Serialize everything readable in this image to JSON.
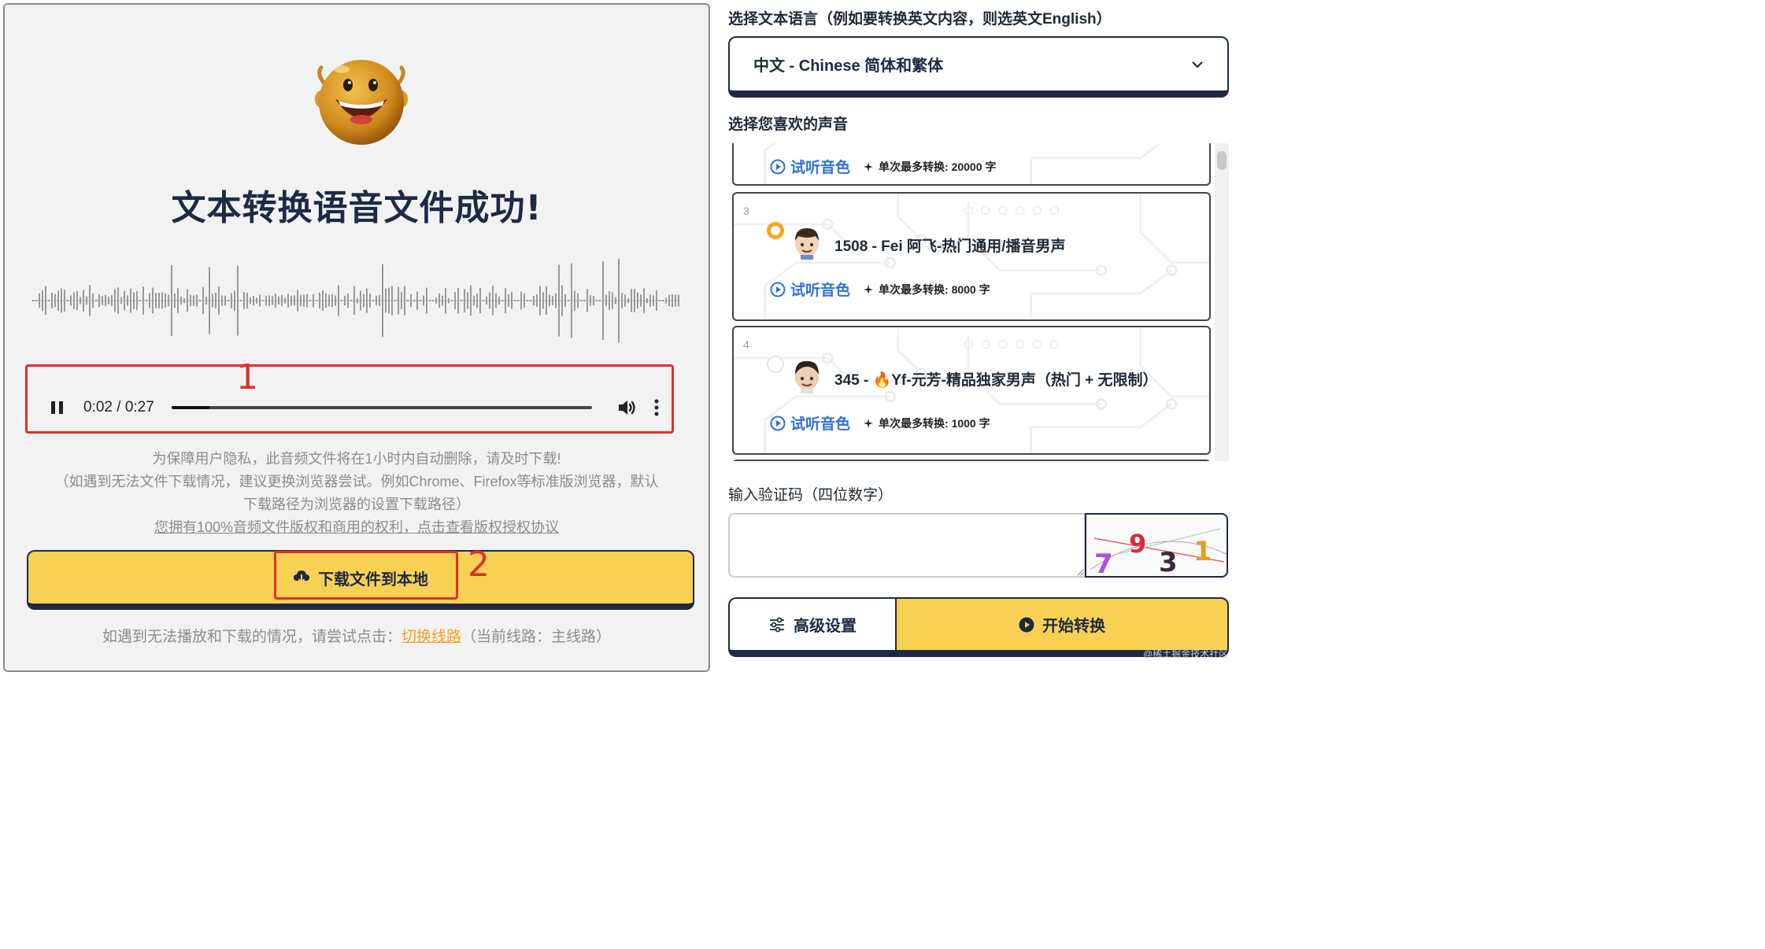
{
  "left": {
    "title": "文本转换语音文件成功!",
    "player": {
      "time": "0:02 / 0:27",
      "current": "0:02",
      "duration": "0:27",
      "progress_fraction": 0.09
    },
    "notice_line1": "为保障用户隐私，此音频文件将在1小时内自动删除，请及时下载!",
    "notice_line2": "（如遇到无法文件下载情况，建议更换浏览器尝试。例如Chrome、Firefox等标准版浏览器，默认",
    "notice_line3": "下载路径为浏览器的设置下载路径）",
    "license_link": "您拥有100%音频文件版权和商用的权利，点击查看版权授权协议",
    "download_label": "下载文件到本地",
    "switch_prefix": "如遇到无法播放和下载的情况，请尝试点击：",
    "switch_link": "切换线路",
    "switch_suffix": "（当前线路：主线路）",
    "annotations": [
      "1",
      "2"
    ]
  },
  "right": {
    "lang_label": "选择文本语言（例如要转换英文内容，则选英文English）",
    "lang_value": "中文 - Chinese 简体和繁体",
    "voice_label": "选择您喜欢的声音",
    "voices": [
      {
        "index": "",
        "name": "",
        "listen": "试听音色",
        "max": "单次最多转换: 20000 字",
        "selected": false
      },
      {
        "index": "3",
        "name": "1508 - Fei 阿飞-热门通用/播音男声",
        "listen": "试听音色",
        "max": "单次最多转换: 8000 字",
        "selected": true
      },
      {
        "index": "4",
        "name": "345 - 🔥Yf-元芳-精品独家男声（热门 + 无限制）",
        "listen": "试听音色",
        "max": "单次最多转换: 1000 字",
        "selected": false
      }
    ],
    "captcha_label": "输入验证码（四位数字）",
    "captcha_value": "",
    "captcha_digits": [
      "7",
      "9",
      "3",
      "1"
    ],
    "settings_label": "高级设置",
    "start_label": "开始转换"
  },
  "watermark": "@稀土掘金技术社区",
  "colors": {
    "navy": "#1e2a44",
    "yellow": "#f8d154",
    "annotation_red": "#e0302a",
    "link_blue": "#2f72d8",
    "link_orange": "#f0a020",
    "radio_selected": "#f5a623"
  }
}
